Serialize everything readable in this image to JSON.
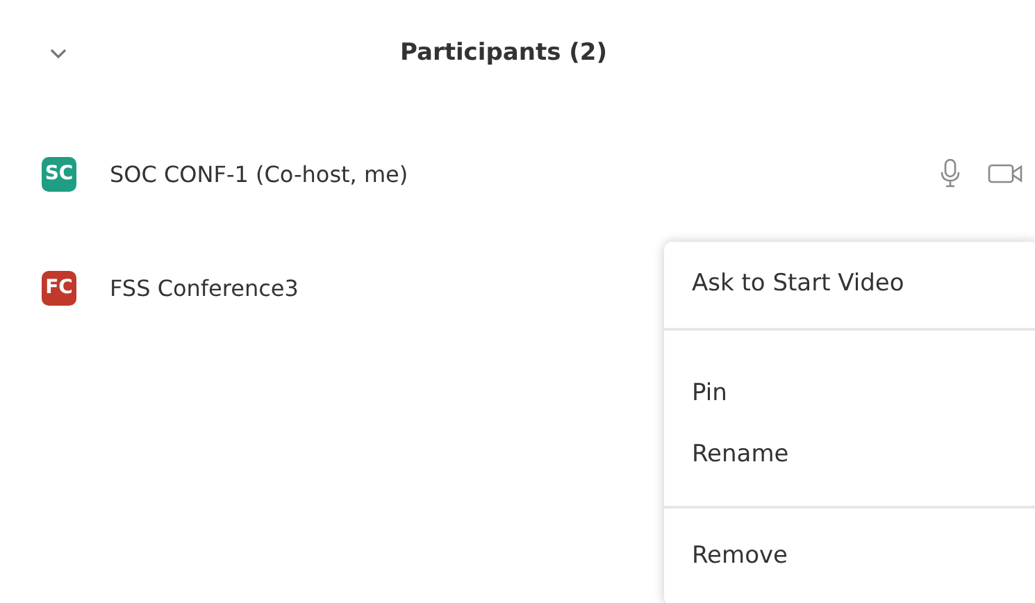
{
  "panel": {
    "title": "Participants (2)"
  },
  "participants": [
    {
      "initials": "SC",
      "name": "SOC CONF-1 (Co-host, me)",
      "color": "#1f9e83",
      "controls_shown": true
    },
    {
      "initials": "FC",
      "name": "FSS Conference3",
      "color": "#c0392b"
    }
  ],
  "context_menu": {
    "groups": [
      {
        "items": [
          {
            "label": "Ask to Start Video"
          }
        ]
      },
      {
        "items": [
          {
            "label": "Pin"
          },
          {
            "label": "Rename"
          }
        ]
      },
      {
        "items": [
          {
            "label": "Remove"
          }
        ]
      }
    ]
  }
}
